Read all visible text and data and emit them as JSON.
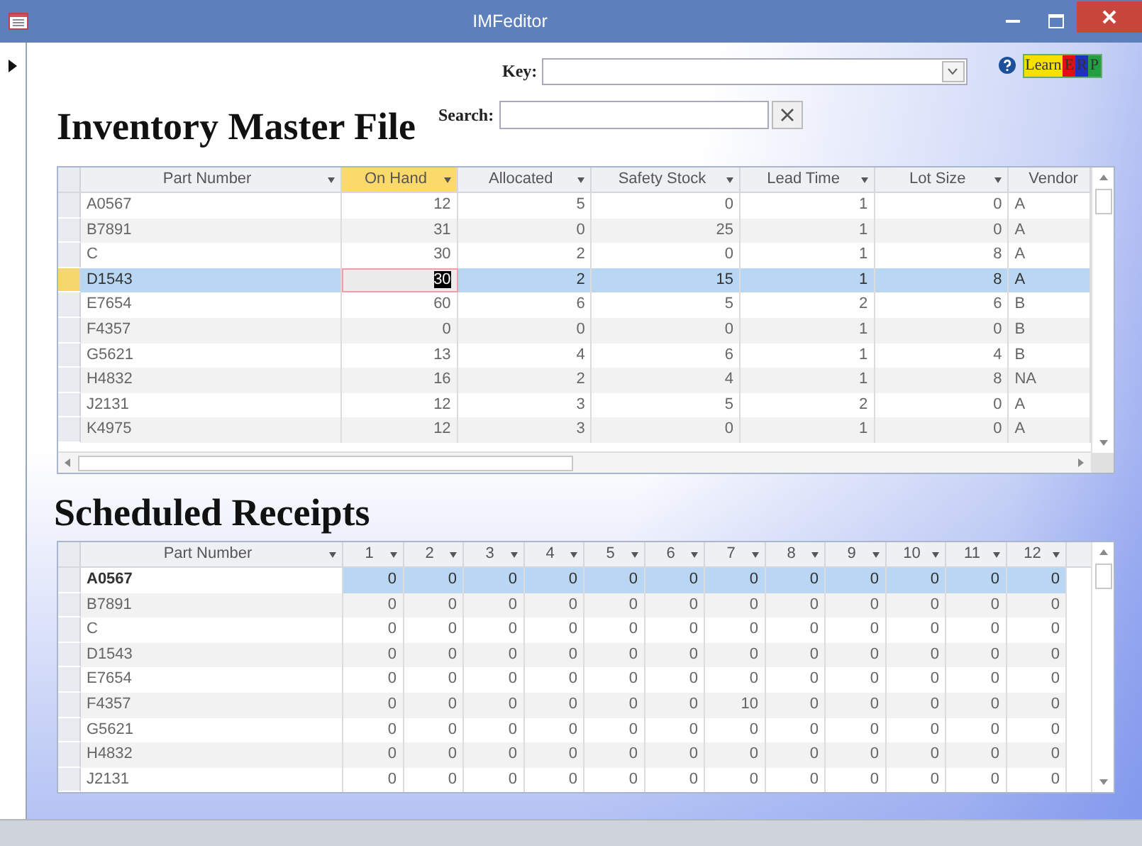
{
  "window": {
    "title": "IMFeditor"
  },
  "key_field": {
    "label": "Key:"
  },
  "search": {
    "label": "Search:"
  },
  "logo": [
    {
      "text": "Learn",
      "color": "#f5e000"
    },
    {
      "text": "E",
      "color": "#e01010"
    },
    {
      "text": "R",
      "color": "#2030c0"
    },
    {
      "text": "P",
      "color": "#20a040"
    }
  ],
  "inventory": {
    "title": "Inventory Master File",
    "columns": [
      {
        "label": "Part Number",
        "kind": "text",
        "highlighted": false,
        "focused": false
      },
      {
        "label": "On Hand",
        "kind": "number",
        "highlighted": true,
        "focused": true
      },
      {
        "label": "Allocated",
        "kind": "number",
        "highlighted": false,
        "focused": false
      },
      {
        "label": "Safety Stock",
        "kind": "number",
        "highlighted": false,
        "focused": false
      },
      {
        "label": "Lead Time",
        "kind": "number",
        "highlighted": false,
        "focused": false
      },
      {
        "label": "Lot Size",
        "kind": "number",
        "highlighted": false,
        "focused": false
      },
      {
        "label": "Vendor",
        "kind": "text",
        "highlighted": false,
        "focused": false
      }
    ],
    "rows": [
      {
        "selected": false,
        "cells": [
          "A0567",
          "12",
          "5",
          "0",
          "1",
          "0",
          "A"
        ]
      },
      {
        "selected": false,
        "cells": [
          "B7891",
          "31",
          "0",
          "25",
          "1",
          "0",
          "A"
        ]
      },
      {
        "selected": false,
        "cells": [
          "C",
          "30",
          "2",
          "0",
          "1",
          "8",
          "A"
        ]
      },
      {
        "selected": true,
        "cells": [
          "D1543",
          "30",
          "2",
          "15",
          "1",
          "8",
          "A"
        ]
      },
      {
        "selected": false,
        "cells": [
          "E7654",
          "60",
          "6",
          "5",
          "2",
          "6",
          "B"
        ]
      },
      {
        "selected": false,
        "cells": [
          "F4357",
          "0",
          "0",
          "0",
          "1",
          "0",
          "B"
        ]
      },
      {
        "selected": false,
        "cells": [
          "G5621",
          "13",
          "4",
          "6",
          "1",
          "4",
          "B"
        ]
      },
      {
        "selected": false,
        "cells": [
          "H4832",
          "16",
          "2",
          "4",
          "1",
          "8",
          "NA"
        ]
      },
      {
        "selected": false,
        "cells": [
          "J2131",
          "12",
          "3",
          "5",
          "2",
          "0",
          "A"
        ]
      },
      {
        "selected": false,
        "cells": [
          "K4975",
          "12",
          "3",
          "0",
          "1",
          "0",
          "A"
        ]
      }
    ]
  },
  "scheduled": {
    "title": "Scheduled Receipts",
    "columns": [
      {
        "label": "Part Number",
        "kind": "text",
        "highlighted": false,
        "focused": true
      },
      {
        "label": "1",
        "kind": "number",
        "highlighted": false,
        "focused": false
      },
      {
        "label": "2",
        "kind": "number",
        "highlighted": false,
        "focused": false
      },
      {
        "label": "3",
        "kind": "number",
        "highlighted": false,
        "focused": false
      },
      {
        "label": "4",
        "kind": "number",
        "highlighted": false,
        "focused": false
      },
      {
        "label": "5",
        "kind": "number",
        "highlighted": false,
        "focused": false
      },
      {
        "label": "6",
        "kind": "number",
        "highlighted": false,
        "focused": false
      },
      {
        "label": "7",
        "kind": "number",
        "highlighted": false,
        "focused": false
      },
      {
        "label": "8",
        "kind": "number",
        "highlighted": false,
        "focused": false
      },
      {
        "label": "9",
        "kind": "number",
        "highlighted": false,
        "focused": false
      },
      {
        "label": "10",
        "kind": "number",
        "highlighted": false,
        "focused": false
      },
      {
        "label": "11",
        "kind": "number",
        "highlighted": false,
        "focused": false
      },
      {
        "label": "12",
        "kind": "number",
        "highlighted": false,
        "focused": false
      }
    ],
    "rows": [
      {
        "selected": true,
        "cells": [
          "A0567",
          "0",
          "0",
          "0",
          "0",
          "0",
          "0",
          "0",
          "0",
          "0",
          "0",
          "0",
          "0"
        ]
      },
      {
        "selected": false,
        "cells": [
          "B7891",
          "0",
          "0",
          "0",
          "0",
          "0",
          "0",
          "0",
          "0",
          "0",
          "0",
          "0",
          "0"
        ]
      },
      {
        "selected": false,
        "cells": [
          "C",
          "0",
          "0",
          "0",
          "0",
          "0",
          "0",
          "0",
          "0",
          "0",
          "0",
          "0",
          "0"
        ]
      },
      {
        "selected": false,
        "cells": [
          "D1543",
          "0",
          "0",
          "0",
          "0",
          "0",
          "0",
          "0",
          "0",
          "0",
          "0",
          "0",
          "0"
        ]
      },
      {
        "selected": false,
        "cells": [
          "E7654",
          "0",
          "0",
          "0",
          "0",
          "0",
          "0",
          "0",
          "0",
          "0",
          "0",
          "0",
          "0"
        ]
      },
      {
        "selected": false,
        "cells": [
          "F4357",
          "0",
          "0",
          "0",
          "0",
          "0",
          "0",
          "10",
          "0",
          "0",
          "0",
          "0",
          "0"
        ]
      },
      {
        "selected": false,
        "cells": [
          "G5621",
          "0",
          "0",
          "0",
          "0",
          "0",
          "0",
          "0",
          "0",
          "0",
          "0",
          "0",
          "0"
        ]
      },
      {
        "selected": false,
        "cells": [
          "H4832",
          "0",
          "0",
          "0",
          "0",
          "0",
          "0",
          "0",
          "0",
          "0",
          "0",
          "0",
          "0"
        ]
      },
      {
        "selected": false,
        "cells": [
          "J2131",
          "0",
          "0",
          "0",
          "0",
          "0",
          "0",
          "0",
          "0",
          "0",
          "0",
          "0",
          "0"
        ]
      }
    ]
  }
}
